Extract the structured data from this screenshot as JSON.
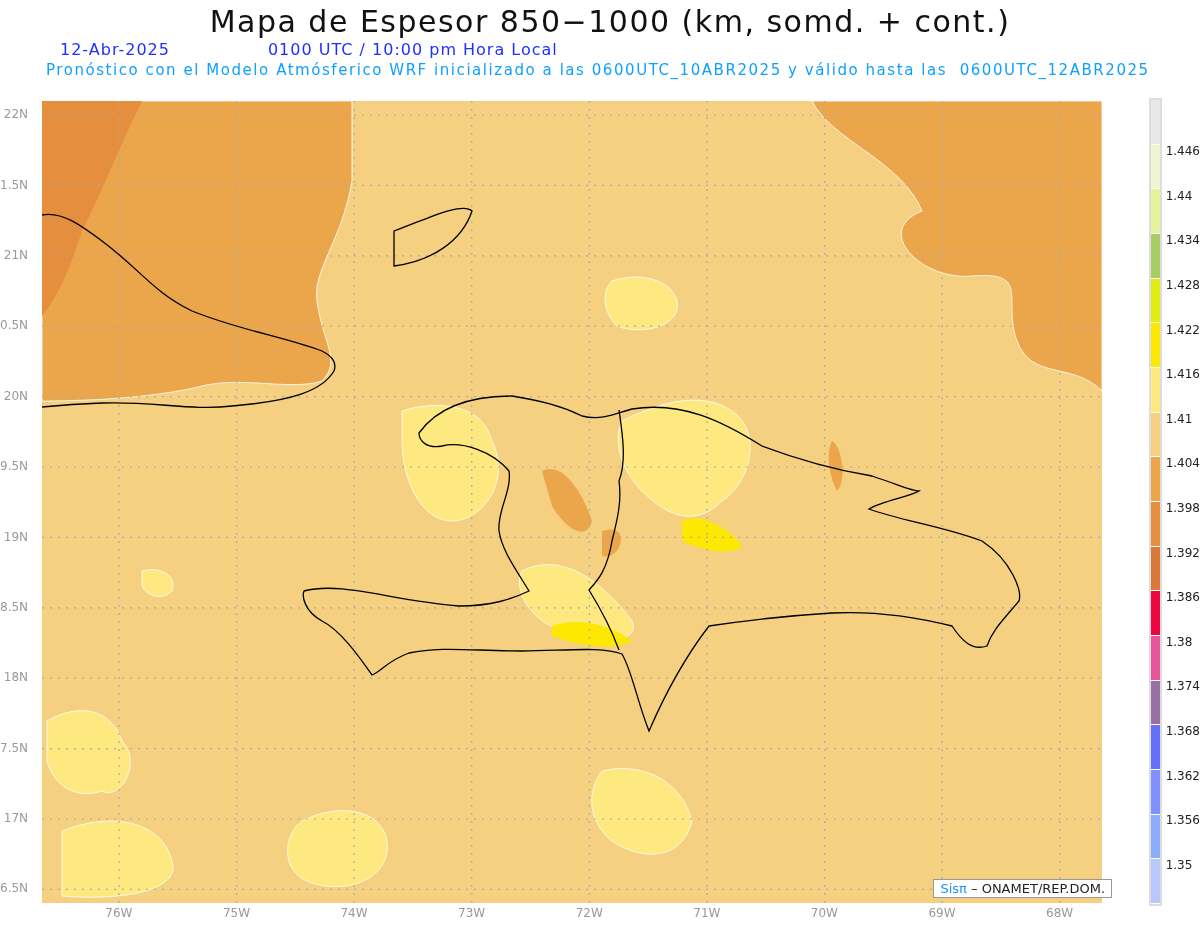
{
  "title": "Mapa de Espesor 850−1000 (km, somd. + cont.)",
  "date": "12-Abr-2025",
  "time": "0100 UTC / 10:00 pm Hora Local",
  "subtitle": "Pronóstico con el Modelo Atmósferico WRF inicializado a las 0600UTC_10ABR2025 y válido hasta las  0600UTC_12ABR2025",
  "map": {
    "lat_labels": [
      "22N",
      "1.5N",
      "21N",
      "0.5N",
      "20N",
      "9.5N",
      "19N",
      "8.5N",
      "18N",
      "7.5N",
      "17N",
      "6.5N"
    ],
    "lon_labels": [
      "76W",
      "75W",
      "74W",
      "73W",
      "72W",
      "71W",
      "70W",
      "69W",
      "68W"
    ]
  },
  "legend": {
    "segments": [
      {
        "color": "#e8e8e8"
      },
      {
        "color": "#f0f4d0"
      },
      {
        "color": "#e6f29a"
      },
      {
        "color": "#a8cc66"
      },
      {
        "color": "#e0ec14"
      },
      {
        "color": "#fce800"
      },
      {
        "color": "#fee880"
      },
      {
        "color": "#f4d080"
      },
      {
        "color": "#eba54a"
      },
      {
        "color": "#e58e3e"
      },
      {
        "color": "#d97838"
      },
      {
        "color": "#ee0440"
      },
      {
        "color": "#e8559a"
      },
      {
        "color": "#9870a4"
      },
      {
        "color": "#6470f8"
      },
      {
        "color": "#8090fc"
      },
      {
        "color": "#8cacfc"
      },
      {
        "color": "#b8c8fc"
      }
    ],
    "labels": [
      "1.446",
      "1.44",
      "1.434",
      "1.428",
      "1.422",
      "1.416",
      "1.41",
      "1.404",
      "1.398",
      "1.392",
      "1.386",
      "1.38",
      "1.374",
      "1.368",
      "1.362",
      "1.356",
      "1.35"
    ]
  },
  "credit": {
    "brand": "Sisπ",
    "text": "– ONAMET/REP.DOM."
  }
}
